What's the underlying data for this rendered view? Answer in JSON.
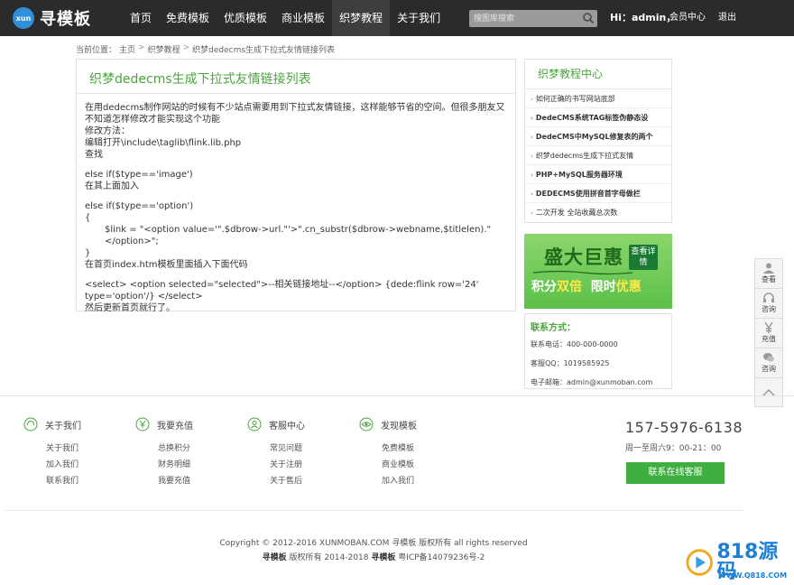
{
  "header": {
    "logo_badge": "xun",
    "logo_text": "寻模板",
    "nav": [
      "首页",
      "免费模板",
      "优质模板",
      "商业模板",
      "织梦教程",
      "关于我们"
    ],
    "search_placeholder": "搜图库搜索",
    "greeting": "Hi：admin，",
    "member_center": "会员中心",
    "logout": "退出"
  },
  "breadcrumb": {
    "prefix": "当前位置：",
    "home": "主页",
    "sep": ">",
    "category": "织梦教程",
    "current": "织梦dedecms生成下拉式友情链接列表"
  },
  "article": {
    "title": "织梦dedecms生成下拉式友情链接列表",
    "lines": {
      "l1": "在用dedecms制作网站的时候有不少站点需要用到下拉式友情链接，这样能够节省的空间。但很多朋友又不知道怎样修改才能实现这个功能",
      "l2": "修改方法：",
      "l3": "编辑打开\\include\\taglib\\flink.lib.php",
      "l4": "查找",
      "l5": "else if($type=='image')",
      "l6": "在其上面加入",
      "l7": "else if($type=='option')",
      "l8": "{",
      "l9": "$link = \"<option value='\".$dbrow->url.\"'>\".cn_substr($dbrow->webname,$titlelen).\"</option>\";",
      "l10": "}",
      "l11": "在首页index.htm模板里面插入下面代码",
      "l12": "<select> <option selected=\"selected\">--相关链接地址--</option> {dede:flink row='24' type='option'/} </select>",
      "l13": "然后更新首页就行了。"
    }
  },
  "sidebar": {
    "title": "织梦教程中心",
    "items": [
      "如何正确的书写网站底部",
      "DedeCMS系统TAG标签伪静态设",
      "DedeCMS中MySQL修复表的两个",
      "织梦dedecms生成下拉式友情",
      "PHP+MySQL服务器环境",
      "DEDECMS使用拼音首字母做栏",
      "二次开发 全站收藏总次数"
    ],
    "arrow": "›"
  },
  "promo": {
    "headline": "盛大巨惠",
    "tag": "查看详情",
    "sub_a": "积分",
    "sub_b": "双倍",
    "sub_c": "限时",
    "sub_d": "优惠"
  },
  "contact": {
    "title": "联系方式：",
    "phone": "联系电话：400-000-0000",
    "qq": "客服QQ：1019585925",
    "email": "电子邮箱：admin@xunmoban.com"
  },
  "float_bar": {
    "items": [
      "查看",
      "咨询",
      "充值",
      "咨询"
    ]
  },
  "footer": {
    "cols": [
      {
        "head": "关于我们",
        "links": [
          "关于我们",
          "加入我们",
          "联系我们"
        ]
      },
      {
        "head": "我要充值",
        "links": [
          "总换积分",
          "财务明细",
          "我要充值"
        ]
      },
      {
        "head": "客服中心",
        "links": [
          "常见问题",
          "关于注册",
          "关于售后"
        ]
      },
      {
        "head": "发现模板",
        "links": [
          "免费模板",
          "商业模板",
          "加入我们"
        ]
      }
    ],
    "phone": "157-5976-6138",
    "hours": "周一至周六9：00-21：00",
    "cs_button": "联系在线客服",
    "copyright": "Copyright © 2012-2016 XUNMOBAN.COM 寻模板 版权所有 all rights reserved",
    "copyright2_a": "寻模板",
    "copyright2_b": " 版权所有 2014-2018 ",
    "copyright2_c": "寻模板",
    "copyright2_d": " 粤ICP备14079236号-2"
  },
  "watermark": {
    "text": "818源码",
    "url": "WWW.Q818.COM"
  },
  "colors": {
    "accent_green": "#4aa63c",
    "button_green": "#3eae40",
    "topbar": "#2b2b2b"
  }
}
